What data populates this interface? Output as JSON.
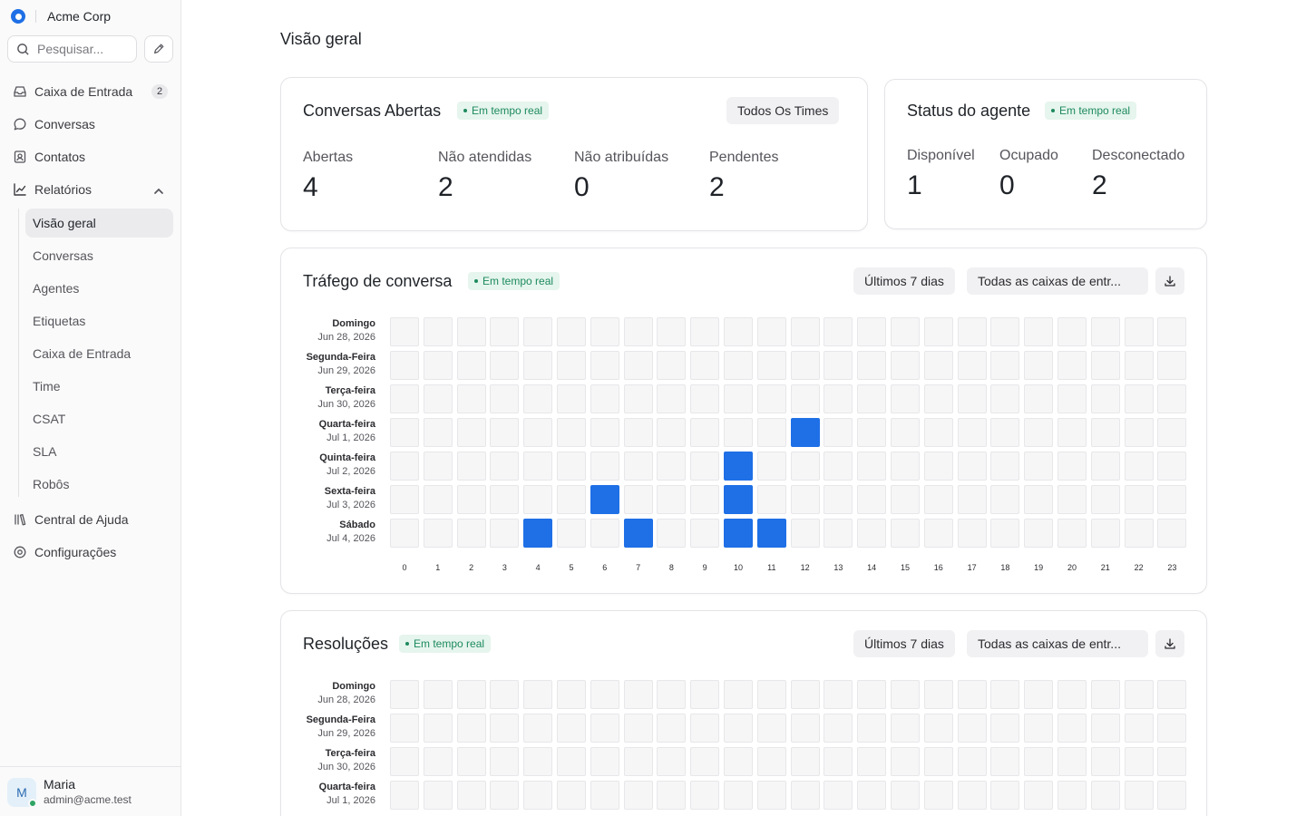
{
  "brand": {
    "name": "Acme Corp"
  },
  "search": {
    "placeholder": "Pesquisar..."
  },
  "nav": {
    "items": [
      {
        "label": "Caixa de Entrada",
        "icon": "inbox-icon",
        "badge": "2"
      },
      {
        "label": "Conversas",
        "icon": "chat-bubble-icon"
      },
      {
        "label": "Contatos",
        "icon": "contact-card-icon"
      },
      {
        "label": "Relatórios",
        "icon": "line-chart-icon",
        "expanded": true
      }
    ],
    "sub_items": [
      {
        "label": "Visão geral",
        "active": true
      },
      {
        "label": "Conversas"
      },
      {
        "label": "Agentes"
      },
      {
        "label": "Etiquetas"
      },
      {
        "label": "Caixa de Entrada"
      },
      {
        "label": "Time"
      },
      {
        "label": "CSAT"
      },
      {
        "label": "SLA"
      },
      {
        "label": "Robôs"
      }
    ],
    "bottom_items": [
      {
        "label": "Central de Ajuda",
        "icon": "library-icon"
      },
      {
        "label": "Configurações",
        "icon": "settings-icon"
      }
    ]
  },
  "user": {
    "initial": "M",
    "name": "Maria",
    "email": "admin@acme.test",
    "status_color": "#2fa464"
  },
  "page": {
    "title": "Visão geral"
  },
  "live_label": "Em tempo real",
  "open_conversations": {
    "title": "Conversas Abertas",
    "team_filter": "Todos Os Times",
    "metrics": [
      {
        "label": "Abertas",
        "value": "4"
      },
      {
        "label": "Não atendidas",
        "value": "2"
      },
      {
        "label": "Não atribuídas",
        "value": "0"
      },
      {
        "label": "Pendentes",
        "value": "2"
      }
    ]
  },
  "agent_status": {
    "title": "Status do agente",
    "metrics": [
      {
        "label": "Disponível",
        "value": "1"
      },
      {
        "label": "Ocupado",
        "value": "0"
      },
      {
        "label": "Desconectado",
        "value": "2"
      }
    ]
  },
  "days": [
    {
      "day": "Domingo",
      "date": "Jun 28, 2026"
    },
    {
      "day": "Segunda-Feira",
      "date": "Jun 29, 2026"
    },
    {
      "day": "Terça-feira",
      "date": "Jun 30, 2026"
    },
    {
      "day": "Quarta-feira",
      "date": "Jul 1, 2026"
    },
    {
      "day": "Quinta-feira",
      "date": "Jul 2, 2026"
    },
    {
      "day": "Sexta-feira",
      "date": "Jul 3, 2026"
    },
    {
      "day": "Sábado",
      "date": "Jul 4, 2026"
    }
  ],
  "hours": [
    "0",
    "1",
    "2",
    "3",
    "4",
    "5",
    "6",
    "7",
    "8",
    "9",
    "10",
    "11",
    "12",
    "13",
    "14",
    "15",
    "16",
    "17",
    "18",
    "19",
    "20",
    "21",
    "22",
    "23"
  ],
  "traffic": {
    "title": "Tráfego de conversa",
    "range_filter": "Últimos 7 dias",
    "inbox_filter": "Todas as caixas de entr...",
    "active_cells": [
      {
        "day": 3,
        "hour": 12
      },
      {
        "day": 4,
        "hour": 10
      },
      {
        "day": 5,
        "hour": 6
      },
      {
        "day": 5,
        "hour": 10
      },
      {
        "day": 6,
        "hour": 4
      },
      {
        "day": 6,
        "hour": 7
      },
      {
        "day": 6,
        "hour": 10
      },
      {
        "day": 6,
        "hour": 11
      }
    ]
  },
  "resolutions": {
    "title": "Resoluções",
    "range_filter": "Últimos 7 dias",
    "inbox_filter": "Todas as caixas de entr...",
    "visible_days": 4,
    "active_cells": []
  },
  "colors": {
    "accent": "#1f6fe6",
    "live_badge_bg": "#e6f5ee",
    "live_badge_text": "#1d8a5e"
  }
}
